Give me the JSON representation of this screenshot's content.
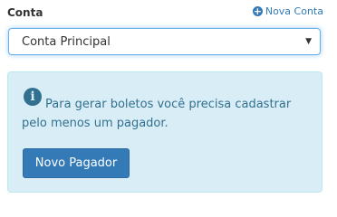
{
  "account_field": {
    "label": "Conta",
    "new_account_link": "Nova Conta",
    "new_account_icon": "plus-circle-icon",
    "selected": "Conta Principal"
  },
  "info_panel": {
    "icon": "info-circle-icon",
    "message": "Para gerar boletos você precisa cadastrar pelo menos um pagador.",
    "button_label": "Novo Pagador"
  },
  "colors": {
    "primary": "#337ab7",
    "info_background": "#d9edf7",
    "info_text": "#31708f",
    "focus_border": "#66afe9"
  }
}
